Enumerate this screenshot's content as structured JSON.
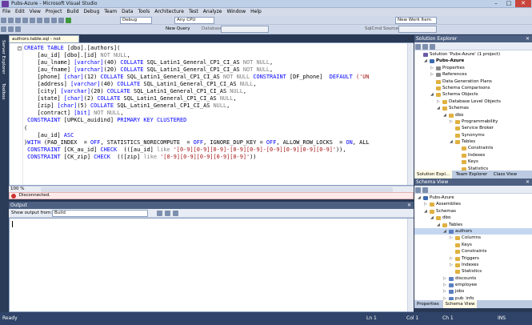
{
  "window": {
    "title": "Pubs-Azure - Microsoft Visual Studio",
    "min": "–",
    "max": "□",
    "close": "✕"
  },
  "menu": [
    "File",
    "Edit",
    "View",
    "Project",
    "Build",
    "Debug",
    "Team",
    "Data",
    "Tools",
    "Architecture",
    "Test",
    "Analyze",
    "Window",
    "Help"
  ],
  "toolbar": {
    "config": "Debug",
    "platform": "Any CPU",
    "new_query": "New Query",
    "database_label": "Database:",
    "new_work_item": "New Work Item",
    "sqlcmd": "SqlCmd Source:"
  },
  "left_tabs": [
    "Server Explorer",
    "Toolbox"
  ],
  "editor": {
    "tab_label": "authors.table.sql - not connected",
    "close": "✕",
    "zoom": "100 %",
    "status": "Disconnected.",
    "lines": [
      [
        [
          "kw",
          "CREATE TABLE "
        ],
        [
          "plain",
          "[dbo].[authors]("
        ]
      ],
      [
        [
          "plain",
          "    [au_id] [dbo].[id] "
        ],
        [
          "gr",
          "NOT NULL"
        ],
        [
          "plain",
          ","
        ]
      ],
      [
        [
          "plain",
          "    [au_lname] "
        ],
        [
          "kw",
          "[varchar]"
        ],
        [
          "plain",
          "(40) "
        ],
        [
          "kw",
          "COLLATE "
        ],
        [
          "plain",
          "SQL_Latin1_General_CP1_CI_AS "
        ],
        [
          "gr",
          "NOT NULL"
        ],
        [
          "plain",
          ","
        ]
      ],
      [
        [
          "plain",
          "    [au_fname] "
        ],
        [
          "kw",
          "[varchar]"
        ],
        [
          "plain",
          "(20) "
        ],
        [
          "kw",
          "COLLATE "
        ],
        [
          "plain",
          "SQL_Latin1_General_CP1_CI_AS "
        ],
        [
          "gr",
          "NOT NULL"
        ],
        [
          "plain",
          ","
        ]
      ],
      [
        [
          "plain",
          "    [phone] "
        ],
        [
          "kw",
          "[char]"
        ],
        [
          "plain",
          "(12) "
        ],
        [
          "kw",
          "COLLATE "
        ],
        [
          "plain",
          "SQL_Latin1_General_CP1_CI_AS "
        ],
        [
          "gr",
          "NOT NULL "
        ],
        [
          "kw",
          "CONSTRAINT "
        ],
        [
          "plain",
          "[DF_phone]  "
        ],
        [
          "kw",
          "DEFAULT "
        ],
        [
          "str",
          "('UN"
        ]
      ],
      [
        [
          "plain",
          "    [address] "
        ],
        [
          "kw",
          "[varchar]"
        ],
        [
          "plain",
          "(40) "
        ],
        [
          "kw",
          "COLLATE "
        ],
        [
          "plain",
          "SQL_Latin1_General_CP1_CI_AS "
        ],
        [
          "gr",
          "NULL"
        ],
        [
          "plain",
          ","
        ]
      ],
      [
        [
          "plain",
          "    [city] "
        ],
        [
          "kw",
          "[varchar]"
        ],
        [
          "plain",
          "(20) "
        ],
        [
          "kw",
          "COLLATE "
        ],
        [
          "plain",
          "SQL_Latin1_General_CP1_CI_AS "
        ],
        [
          "gr",
          "NULL"
        ],
        [
          "plain",
          ","
        ]
      ],
      [
        [
          "plain",
          "    [state] "
        ],
        [
          "kw",
          "[char]"
        ],
        [
          "plain",
          "(2) "
        ],
        [
          "kw",
          "COLLATE "
        ],
        [
          "plain",
          "SQL_Latin1_General_CP1_CI_AS "
        ],
        [
          "gr",
          "NULL"
        ],
        [
          "plain",
          ","
        ]
      ],
      [
        [
          "plain",
          "    [zip] "
        ],
        [
          "kw",
          "[char]"
        ],
        [
          "plain",
          "(5) "
        ],
        [
          "kw",
          "COLLATE "
        ],
        [
          "plain",
          "SQL_Latin1_General_CP1_CI_AS "
        ],
        [
          "gr",
          "NULL"
        ],
        [
          "plain",
          ","
        ]
      ],
      [
        [
          "plain",
          "    [contract] "
        ],
        [
          "kw",
          "[bit] "
        ],
        [
          "gr",
          "NOT NULL"
        ],
        [
          "plain",
          ","
        ]
      ],
      [
        [
          "plain",
          " "
        ],
        [
          "kw",
          "CONSTRAINT "
        ],
        [
          "plain",
          "[UPKCL_auidind] "
        ],
        [
          "kw",
          "PRIMARY KEY CLUSTERED"
        ]
      ],
      [
        [
          "plain",
          "("
        ]
      ],
      [
        [
          "plain",
          "    [au_id] "
        ],
        [
          "kw",
          "ASC"
        ]
      ],
      [
        [
          "plain",
          ")"
        ],
        [
          "kw",
          "WITH "
        ],
        [
          "plain",
          "(PAD_INDEX  = "
        ],
        [
          "kw",
          "OFF"
        ],
        [
          "plain",
          ", STATISTICS_NORECOMPUTE  = "
        ],
        [
          "kw",
          "OFF"
        ],
        [
          "plain",
          ", IGNORE_DUP_KEY = "
        ],
        [
          "kw",
          "OFF"
        ],
        [
          "plain",
          ", ALLOW_ROW_LOCKS  = "
        ],
        [
          "kw",
          "ON"
        ],
        [
          "plain",
          ", ALL"
        ]
      ],
      [
        [
          "plain",
          " "
        ],
        [
          "kw",
          "CONSTRAINT "
        ],
        [
          "plain",
          "[CK_au_id] "
        ],
        [
          "kw",
          "CHECK  "
        ],
        [
          "plain",
          "(([au_id] "
        ],
        [
          "gr",
          "like "
        ],
        [
          "str",
          "'[0-9][0-9][0-9]-[0-9][0-9]-[0-9][0-9][0-9][0-9]'"
        ],
        [
          "plain",
          ")),"
        ]
      ],
      [
        [
          "plain",
          " "
        ],
        [
          "kw",
          "CONSTRAINT "
        ],
        [
          "plain",
          "[CK_zip] "
        ],
        [
          "kw",
          "CHECK  "
        ],
        [
          "plain",
          "(([zip] "
        ],
        [
          "gr",
          "like "
        ],
        [
          "str",
          "'[0-9][0-9][0-9][0-9][0-9]'"
        ],
        [
          "plain",
          "))"
        ]
      ]
    ]
  },
  "output": {
    "title": "Output",
    "show_from_label": "Show output from:",
    "show_from_value": "Build"
  },
  "solution_explorer": {
    "title": "Solution Explorer",
    "tree": [
      {
        "depth": 0,
        "exp": "",
        "icon": "#6a5aa8",
        "label": "Solution 'Pubs-Azure' (1 project)"
      },
      {
        "depth": 1,
        "exp": "◢",
        "icon": "#3c6ab0",
        "label": "Pubs-Azure",
        "bold": true
      },
      {
        "depth": 2,
        "exp": "▷",
        "icon": "#888",
        "label": "Properties"
      },
      {
        "depth": 2,
        "exp": "▷",
        "icon": "#888",
        "label": "References"
      },
      {
        "depth": 2,
        "exp": "",
        "icon": "#e0b040",
        "label": "Data Generation Plans"
      },
      {
        "depth": 2,
        "exp": "",
        "icon": "#e0b040",
        "label": "Schema Comparisons"
      },
      {
        "depth": 2,
        "exp": "◢",
        "icon": "#e0b040",
        "label": "Schema Objects"
      },
      {
        "depth": 3,
        "exp": "▷",
        "icon": "#e0b040",
        "label": "Database Level Objects"
      },
      {
        "depth": 3,
        "exp": "◢",
        "icon": "#e0b040",
        "label": "Schemas"
      },
      {
        "depth": 4,
        "exp": "◢",
        "icon": "#e0b040",
        "label": "dbo"
      },
      {
        "depth": 5,
        "exp": "▷",
        "icon": "#e0b040",
        "label": "Programmability"
      },
      {
        "depth": 5,
        "exp": "",
        "icon": "#e0b040",
        "label": "Service Broker"
      },
      {
        "depth": 5,
        "exp": "",
        "icon": "#e0b040",
        "label": "Synonyms"
      },
      {
        "depth": 5,
        "exp": "◢",
        "icon": "#e0b040",
        "label": "Tables"
      },
      {
        "depth": 6,
        "exp": "",
        "icon": "#e0b040",
        "label": "Constraints"
      },
      {
        "depth": 6,
        "exp": "",
        "icon": "#e0b040",
        "label": "Indexes"
      },
      {
        "depth": 6,
        "exp": "",
        "icon": "#e0b040",
        "label": "Keys"
      },
      {
        "depth": 6,
        "exp": "",
        "icon": "#e0b040",
        "label": "Statistics"
      }
    ],
    "tabs": [
      "Solution Expl...",
      "Team Explorer",
      "Class View"
    ]
  },
  "schema_view": {
    "title": "Schema View",
    "tree": [
      {
        "depth": 0,
        "exp": "◢",
        "icon": "#3c6ab0",
        "label": "Pubs-Azure"
      },
      {
        "depth": 1,
        "exp": "▷",
        "icon": "#e0b040",
        "label": "Assemblies"
      },
      {
        "depth": 1,
        "exp": "◢",
        "icon": "#e0b040",
        "label": "Schemas"
      },
      {
        "depth": 2,
        "exp": "◢",
        "icon": "#e0b040",
        "label": "dbo"
      },
      {
        "depth": 3,
        "exp": "◢",
        "icon": "#e0b040",
        "label": "Tables"
      },
      {
        "depth": 4,
        "exp": "◢",
        "icon": "#5b7fc0",
        "label": "authors",
        "selected": true
      },
      {
        "depth": 5,
        "exp": "▷",
        "icon": "#e0b040",
        "label": "Columns"
      },
      {
        "depth": 5,
        "exp": "",
        "icon": "#e0b040",
        "label": "Keys"
      },
      {
        "depth": 5,
        "exp": "",
        "icon": "#e0b040",
        "label": "Constraints"
      },
      {
        "depth": 5,
        "exp": "▷",
        "icon": "#e0b040",
        "label": "Triggers"
      },
      {
        "depth": 5,
        "exp": "▷",
        "icon": "#e0b040",
        "label": "Indexes"
      },
      {
        "depth": 5,
        "exp": "",
        "icon": "#e0b040",
        "label": "Statistics"
      },
      {
        "depth": 4,
        "exp": "▷",
        "icon": "#5b7fc0",
        "label": "discounts"
      },
      {
        "depth": 4,
        "exp": "▷",
        "icon": "#5b7fc0",
        "label": "employee"
      },
      {
        "depth": 4,
        "exp": "▷",
        "icon": "#5b7fc0",
        "label": "jobs"
      },
      {
        "depth": 4,
        "exp": "▷",
        "icon": "#5b7fc0",
        "label": "pub_info"
      }
    ],
    "tabs": [
      "Properties",
      "Schema View"
    ]
  },
  "status": {
    "left": "Ready",
    "ln": "Ln 1",
    "col": "Col 1",
    "ch": "Ch 1",
    "ins": "INS"
  }
}
